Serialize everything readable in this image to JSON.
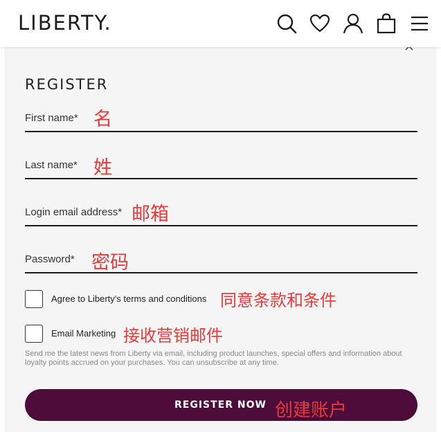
{
  "header": {
    "logo": "LIBERTY.",
    "icons": [
      "search-icon",
      "heart-icon",
      "account-icon",
      "bag-icon",
      "menu-icon"
    ]
  },
  "register": {
    "title": "REGISTER",
    "fields": [
      {
        "label": "First name*",
        "annotation": "名",
        "value": ""
      },
      {
        "label": "Last name*",
        "annotation": "姓",
        "value": ""
      },
      {
        "label": "Login email address*",
        "annotation": "邮箱",
        "value": ""
      },
      {
        "label": "Password*",
        "annotation": "密码",
        "value": ""
      }
    ],
    "checkboxes": [
      {
        "label": "Agree to Liberty's terms and conditions",
        "annotation": "同意条款和条件",
        "checked": false
      },
      {
        "label": "Email Marketing",
        "annotation": "接收营销邮件",
        "checked": false
      }
    ],
    "marketing_note": "Send me the latest news from Liberty via email, including product launches, special offers and information about loyalty points accrued on your purchases. You can unsubscribe at any time.",
    "submit_label": "REGISTER NOW",
    "submit_annotation": "创建账户"
  },
  "colors": {
    "brand_plum": "#4e0c3b",
    "annotation_red": "#e83a3a",
    "panel_bg": "#f5f5f5"
  }
}
